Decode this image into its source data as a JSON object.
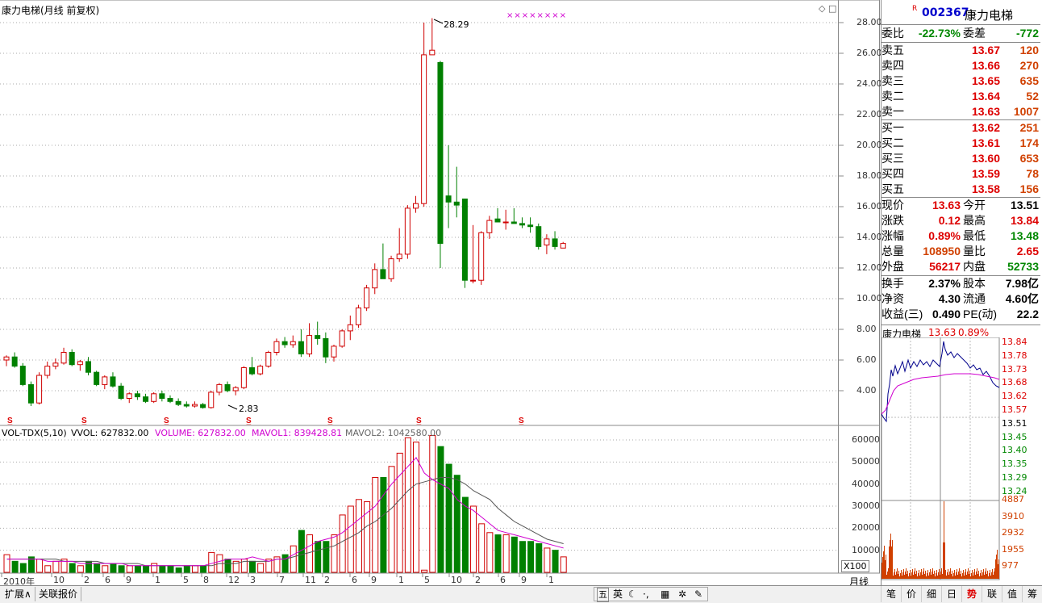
{
  "chart_header": {
    "title": "康力电梯(月线 前复权)",
    "mark_max": "28.29",
    "mark_min": "2.83",
    "stars": "××××××××"
  },
  "vol_header": {
    "name": "VOL-TDX(5,10)",
    "vvol": "VVOL: 627832.00",
    "volume": "VOLUME: 627832.00",
    "mavol1": "MAVOL1: 839428.81",
    "mavol2": "MAVOL2: 1042580.00"
  },
  "price_ticks": [
    "28.00",
    "26.00",
    "24.00",
    "22.00",
    "20.00",
    "18.00",
    "16.00",
    "14.00",
    "12.00",
    "10.00",
    "8.00",
    "6.00",
    "4.00"
  ],
  "vol_ticks": [
    "60000",
    "50000",
    "40000",
    "30000",
    "20000",
    "10000"
  ],
  "vol_unit": "X100",
  "date_labels": [
    "2010年",
    "10",
    "2",
    "6",
    "9",
    "1",
    "5",
    "8",
    "12",
    "3",
    "7",
    "11",
    "2",
    "6",
    "9",
    "1",
    "5",
    "10",
    "2",
    "6",
    "9",
    "1"
  ],
  "period_label": "月线",
  "quote": {
    "code": "002367",
    "name": "康力电梯",
    "r_flag": "R",
    "weibi_label": "委比",
    "weibi_value": "-22.73%",
    "weicha_label": "委差",
    "weicha_value": "-772",
    "sell": [
      {
        "label": "卖五",
        "price": "13.67",
        "vol": "120"
      },
      {
        "label": "卖四",
        "price": "13.66",
        "vol": "270"
      },
      {
        "label": "卖三",
        "price": "13.65",
        "vol": "635"
      },
      {
        "label": "卖二",
        "price": "13.64",
        "vol": "52"
      },
      {
        "label": "卖一",
        "price": "13.63",
        "vol": "1007"
      }
    ],
    "buy": [
      {
        "label": "买一",
        "price": "13.62",
        "vol": "251"
      },
      {
        "label": "买二",
        "price": "13.61",
        "vol": "174"
      },
      {
        "label": "买三",
        "price": "13.60",
        "vol": "653"
      },
      {
        "label": "买四",
        "price": "13.59",
        "vol": "78"
      },
      {
        "label": "买五",
        "price": "13.58",
        "vol": "156"
      }
    ],
    "stats": [
      {
        "l": "现价",
        "v": "13.63",
        "vc": "red",
        "l2": "今开",
        "v2": "13.51",
        "v2c": "black"
      },
      {
        "l": "涨跌",
        "v": "0.12",
        "vc": "red",
        "l2": "最高",
        "v2": "13.84",
        "v2c": "red"
      },
      {
        "l": "涨幅",
        "v": "0.89%",
        "vc": "red",
        "l2": "最低",
        "v2": "13.48",
        "v2c": "green"
      },
      {
        "l": "总量",
        "v": "108950",
        "vc": "orange",
        "l2": "量比",
        "v2": "2.65",
        "v2c": "red"
      },
      {
        "l": "外盘",
        "v": "56217",
        "vc": "red",
        "l2": "内盘",
        "v2": "52733",
        "v2c": "green"
      }
    ],
    "stats2": [
      {
        "l": "换手",
        "v": "2.37%",
        "l2": "股本",
        "v2": "7.98亿"
      },
      {
        "l": "净资",
        "v": "4.30",
        "l2": "流通",
        "v2": "4.60亿"
      },
      {
        "l": "收益(三)",
        "v": "0.490",
        "l2": "PE(动)",
        "v2": "22.2"
      }
    ]
  },
  "intraday": {
    "name": "康力电梯",
    "price": "13.63",
    "pct": "0.89%",
    "price_ticks": [
      "13.84",
      "13.78",
      "13.73",
      "13.68",
      "13.62",
      "13.57",
      "13.51",
      "13.45",
      "13.40",
      "13.35",
      "13.29",
      "13.24"
    ],
    "vol_ticks": [
      "4887",
      "3910",
      "2932",
      "1955",
      "977"
    ]
  },
  "bottom_tabs": [
    "扩展∧",
    "关联报价"
  ],
  "ime": [
    "五",
    "英"
  ],
  "right_tabs": [
    "笔",
    "价",
    "细",
    "日",
    "势",
    "联",
    "值",
    "筹"
  ],
  "colors": {
    "up": "#d00000",
    "down": "#008000",
    "ma1": "#d000d0",
    "ma2": "#555555"
  },
  "chart_data": {
    "type": "candlestick",
    "title": "康力电梯(月线 前复权)",
    "ylim": [
      2,
      29
    ],
    "candles": [
      [
        6.0,
        6.3,
        5.6,
        6.2
      ],
      [
        6.2,
        6.5,
        5.5,
        5.6
      ],
      [
        5.6,
        5.8,
        4.3,
        4.4
      ],
      [
        4.4,
        4.6,
        3.0,
        3.2
      ],
      [
        3.2,
        5.2,
        3.1,
        5.0
      ],
      [
        5.0,
        5.9,
        4.8,
        5.6
      ],
      [
        5.6,
        6.1,
        5.4,
        5.8
      ],
      [
        5.8,
        6.8,
        5.7,
        6.5
      ],
      [
        6.5,
        6.7,
        5.6,
        5.7
      ],
      [
        5.7,
        6.0,
        5.3,
        5.9
      ],
      [
        5.9,
        6.2,
        5.0,
        5.2
      ],
      [
        5.2,
        5.3,
        4.3,
        4.4
      ],
      [
        4.4,
        5.0,
        4.1,
        4.9
      ],
      [
        4.9,
        5.2,
        4.2,
        4.3
      ],
      [
        4.3,
        4.5,
        3.4,
        3.5
      ],
      [
        3.5,
        3.9,
        3.2,
        3.8
      ],
      [
        3.8,
        4.0,
        3.4,
        3.6
      ],
      [
        3.6,
        3.8,
        3.2,
        3.3
      ],
      [
        3.3,
        3.9,
        3.2,
        3.8
      ],
      [
        3.8,
        4.0,
        3.3,
        3.5
      ],
      [
        3.5,
        3.7,
        3.2,
        3.3
      ],
      [
        3.3,
        3.5,
        3.0,
        3.1
      ],
      [
        3.1,
        3.3,
        2.9,
        3.0
      ],
      [
        3.0,
        3.3,
        2.9,
        3.1
      ],
      [
        3.1,
        3.2,
        2.83,
        2.9
      ],
      [
        2.9,
        4.0,
        2.83,
        3.9
      ],
      [
        3.9,
        4.5,
        3.7,
        4.4
      ],
      [
        4.4,
        4.6,
        3.9,
        4.0
      ],
      [
        4.0,
        4.3,
        3.7,
        4.2
      ],
      [
        4.2,
        5.6,
        4.1,
        5.5
      ],
      [
        5.5,
        6.2,
        5.0,
        5.1
      ],
      [
        5.1,
        5.7,
        5.0,
        5.6
      ],
      [
        5.6,
        6.6,
        5.5,
        6.5
      ],
      [
        6.5,
        7.4,
        6.3,
        7.2
      ],
      [
        7.2,
        7.5,
        6.8,
        7.0
      ],
      [
        7.0,
        7.6,
        6.8,
        7.2
      ],
      [
        7.2,
        8.0,
        6.2,
        6.4
      ],
      [
        6.4,
        8.4,
        6.2,
        7.6
      ],
      [
        7.6,
        8.5,
        7.0,
        7.4
      ],
      [
        7.4,
        7.8,
        5.8,
        6.2
      ],
      [
        6.2,
        7.0,
        5.9,
        6.9
      ],
      [
        6.9,
        8.0,
        6.8,
        7.9
      ],
      [
        7.9,
        8.9,
        7.3,
        8.3
      ],
      [
        8.3,
        9.6,
        8.1,
        9.4
      ],
      [
        9.4,
        10.9,
        9.2,
        10.7
      ],
      [
        10.7,
        12.3,
        10.3,
        11.9
      ],
      [
        11.9,
        13.6,
        11.6,
        11.3
      ],
      [
        11.3,
        12.8,
        11.1,
        12.6
      ],
      [
        12.6,
        14.6,
        12.4,
        12.9
      ],
      [
        12.9,
        16.1,
        12.6,
        15.9
      ],
      [
        15.9,
        16.7,
        15.6,
        16.2
      ],
      [
        16.2,
        28.0,
        16.0,
        25.9
      ],
      [
        25.9,
        28.29,
        26.1,
        26.2
      ],
      [
        25.4,
        25.5,
        12.0,
        13.6
      ],
      [
        16.7,
        20.0,
        14.6,
        16.3
      ],
      [
        16.3,
        18.6,
        15.3,
        16.1
      ],
      [
        16.5,
        16.5,
        10.7,
        11.2
      ],
      [
        11.2,
        14.8,
        11.0,
        11.2
      ],
      [
        11.2,
        14.4,
        10.9,
        14.3
      ],
      [
        14.3,
        15.4,
        13.9,
        15.1
      ],
      [
        15.2,
        15.9,
        15.0,
        15.0
      ],
      [
        15.0,
        15.8,
        14.5,
        15.0
      ],
      [
        15.0,
        15.9,
        14.9,
        14.9
      ],
      [
        14.9,
        15.3,
        14.6,
        14.8
      ],
      [
        14.8,
        15.3,
        14.3,
        14.7
      ],
      [
        14.7,
        14.9,
        13.2,
        13.4
      ],
      [
        13.5,
        14.2,
        12.9,
        13.9
      ],
      [
        13.9,
        14.4,
        13.2,
        13.4
      ],
      [
        13.3,
        13.7,
        13.3,
        13.6
      ]
    ],
    "volume": [
      8,
      5,
      4,
      7,
      6,
      3,
      5,
      6,
      4,
      3,
      5,
      4,
      3,
      4,
      3,
      3,
      3,
      3,
      4,
      3,
      3,
      2,
      3,
      3,
      3,
      9,
      8,
      6,
      5,
      6,
      5,
      4,
      6,
      7,
      8,
      12,
      19,
      17,
      14,
      14,
      17,
      26,
      30,
      33,
      32,
      43,
      43,
      48,
      54,
      61,
      59,
      1,
      62,
      57,
      49,
      44,
      34,
      30,
      22,
      18,
      17,
      17,
      16,
      14,
      14,
      13,
      11,
      10,
      7
    ],
    "mavol1": [
      6,
      6,
      6,
      6,
      6,
      5,
      5,
      5,
      5,
      4,
      4,
      4,
      4,
      4,
      4,
      3,
      3,
      3,
      3,
      3,
      3,
      3,
      3,
      3,
      3,
      4,
      5,
      6,
      6,
      6,
      7,
      6,
      5,
      6,
      6,
      8,
      10,
      12,
      14,
      15,
      16,
      18,
      21,
      24,
      27,
      30,
      35,
      40,
      44,
      48,
      52,
      45,
      42,
      40,
      38,
      33,
      30,
      28,
      25,
      22,
      19,
      18,
      17,
      16,
      15,
      14,
      13,
      12,
      11
    ],
    "mavol2": [
      6,
      6,
      6,
      6,
      6,
      6,
      6,
      5,
      5,
      5,
      5,
      5,
      4,
      4,
      4,
      4,
      4,
      3,
      3,
      3,
      3,
      3,
      3,
      3,
      3,
      3,
      4,
      4,
      4,
      5,
      5,
      5,
      5,
      6,
      6,
      7,
      8,
      9,
      10,
      11,
      12,
      14,
      16,
      18,
      21,
      23,
      26,
      29,
      33,
      37,
      40,
      41,
      42,
      43,
      43,
      42,
      40,
      37,
      35,
      33,
      29,
      26,
      23,
      21,
      19,
      17,
      15,
      14,
      13
    ],
    "volume_ylim": [
      0,
      65000
    ]
  }
}
